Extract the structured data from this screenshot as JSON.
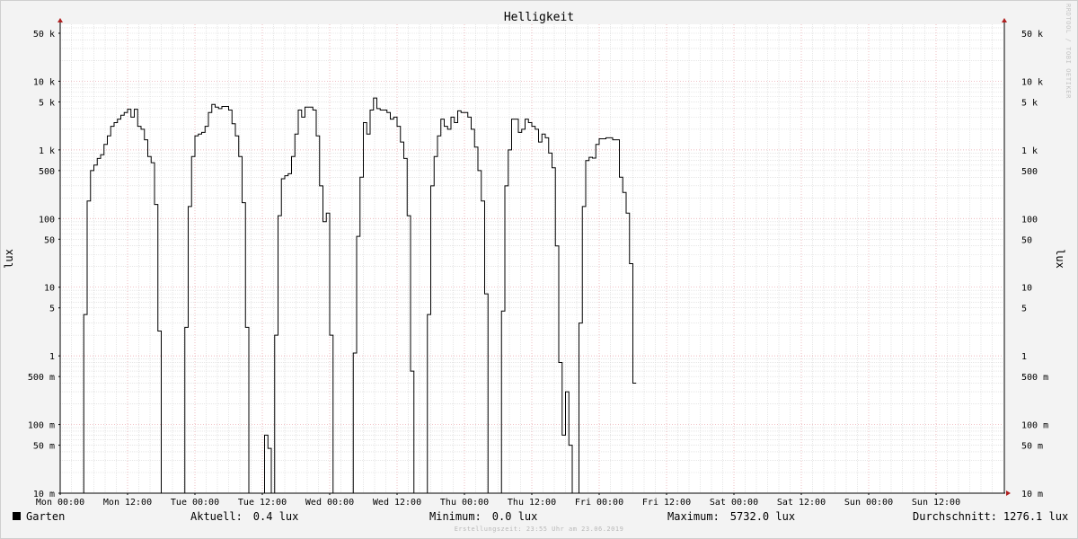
{
  "chart_data": {
    "type": "line",
    "title": "Helligkeit",
    "ylabel": "lux",
    "ylabel_right": "lux",
    "y_scale": "log",
    "ylim": [
      0.01,
      80000
    ],
    "y_ticks": [
      {
        "value": 50000,
        "label": "50 k"
      },
      {
        "value": 10000,
        "label": "10 k"
      },
      {
        "value": 5000,
        "label": "5 k"
      },
      {
        "value": 1000,
        "label": "1 k"
      },
      {
        "value": 500,
        "label": "500"
      },
      {
        "value": 100,
        "label": "100"
      },
      {
        "value": 50,
        "label": "50"
      },
      {
        "value": 10,
        "label": "10"
      },
      {
        "value": 5,
        "label": "5"
      },
      {
        "value": 1,
        "label": "1"
      },
      {
        "value": 0.5,
        "label": "500 m"
      },
      {
        "value": 0.1,
        "label": "100 m"
      },
      {
        "value": 0.05,
        "label": "50 m"
      },
      {
        "value": 0.01,
        "label": "10 m"
      }
    ],
    "x_unit": "hours since Mon 00:00",
    "xlim": [
      0,
      168
    ],
    "x_ticks": [
      {
        "value": 0,
        "label": "Mon 00:00"
      },
      {
        "value": 12,
        "label": "Mon 12:00"
      },
      {
        "value": 24,
        "label": "Tue 00:00"
      },
      {
        "value": 36,
        "label": "Tue 12:00"
      },
      {
        "value": 48,
        "label": "Wed 00:00"
      },
      {
        "value": 60,
        "label": "Wed 12:00"
      },
      {
        "value": 72,
        "label": "Thu 00:00"
      },
      {
        "value": 84,
        "label": "Thu 12:00"
      },
      {
        "value": 96,
        "label": "Fri 00:00"
      },
      {
        "value": 108,
        "label": "Fri 12:00"
      },
      {
        "value": 120,
        "label": "Sat 00:00"
      },
      {
        "value": 132,
        "label": "Sat 12:00"
      },
      {
        "value": 144,
        "label": "Sun 00:00"
      },
      {
        "value": 156,
        "label": "Sun 12:00"
      }
    ],
    "grid": true,
    "legend_position": "bottom-left",
    "series": [
      {
        "name": "Garten",
        "color": "#000000",
        "points": [
          [
            0,
            0.01
          ],
          [
            4.2,
            0.01
          ],
          [
            4.2,
            4
          ],
          [
            4.8,
            4
          ],
          [
            4.8,
            180
          ],
          [
            5.4,
            180
          ],
          [
            5.4,
            500
          ],
          [
            6,
            500
          ],
          [
            6,
            600
          ],
          [
            6.6,
            600
          ],
          [
            6.6,
            750
          ],
          [
            7.2,
            750
          ],
          [
            7.2,
            850
          ],
          [
            7.8,
            850
          ],
          [
            7.8,
            1200
          ],
          [
            8.4,
            1200
          ],
          [
            8.4,
            1600
          ],
          [
            9,
            1600
          ],
          [
            9,
            2200
          ],
          [
            9.6,
            2200
          ],
          [
            9.6,
            2500
          ],
          [
            10.2,
            2500
          ],
          [
            10.2,
            2800
          ],
          [
            10.8,
            2800
          ],
          [
            10.8,
            3200
          ],
          [
            11.4,
            3200
          ],
          [
            11.4,
            3500
          ],
          [
            12,
            3500
          ],
          [
            12,
            3900
          ],
          [
            12.6,
            3900
          ],
          [
            12.6,
            3000
          ],
          [
            13.2,
            3000
          ],
          [
            13.2,
            3900
          ],
          [
            13.8,
            3900
          ],
          [
            13.8,
            2200
          ],
          [
            14.4,
            2200
          ],
          [
            14.4,
            2000
          ],
          [
            15,
            2000
          ],
          [
            15,
            1400
          ],
          [
            15.6,
            1400
          ],
          [
            15.6,
            800
          ],
          [
            16.2,
            800
          ],
          [
            16.2,
            650
          ],
          [
            16.8,
            650
          ],
          [
            16.8,
            160
          ],
          [
            17.4,
            160
          ],
          [
            17.4,
            2.3
          ],
          [
            18,
            2.3
          ],
          [
            18,
            0.01
          ],
          [
            22.2,
            0.01
          ],
          [
            22.2,
            2.6
          ],
          [
            22.8,
            2.6
          ],
          [
            22.8,
            150
          ],
          [
            23.4,
            150
          ],
          [
            23.4,
            800
          ],
          [
            24,
            800
          ],
          [
            24,
            1600
          ],
          [
            24.6,
            1600
          ],
          [
            24.6,
            1700
          ],
          [
            25.2,
            1700
          ],
          [
            25.2,
            1800
          ],
          [
            25.8,
            1800
          ],
          [
            25.8,
            2200
          ],
          [
            26.4,
            2200
          ],
          [
            26.4,
            3500
          ],
          [
            27,
            3500
          ],
          [
            27,
            4600
          ],
          [
            27.6,
            4600
          ],
          [
            27.6,
            4200
          ],
          [
            28.2,
            4200
          ],
          [
            28.2,
            4000
          ],
          [
            28.8,
            4000
          ],
          [
            28.8,
            4300
          ],
          [
            30,
            4300
          ],
          [
            30,
            3800
          ],
          [
            30.6,
            3800
          ],
          [
            30.6,
            2400
          ],
          [
            31.2,
            2400
          ],
          [
            31.2,
            1600
          ],
          [
            31.8,
            1600
          ],
          [
            31.8,
            800
          ],
          [
            32.4,
            800
          ],
          [
            32.4,
            170
          ],
          [
            33,
            170
          ],
          [
            33,
            2.6
          ],
          [
            33.6,
            2.6
          ],
          [
            33.6,
            0.01
          ],
          [
            36.4,
            0.01
          ],
          [
            36.4,
            0.07
          ],
          [
            37,
            0.07
          ],
          [
            37,
            0.045
          ],
          [
            37.6,
            0.045
          ],
          [
            37.6,
            0.01
          ],
          [
            38.2,
            0.01
          ],
          [
            38.2,
            2
          ],
          [
            38.8,
            2
          ],
          [
            38.8,
            110
          ],
          [
            39.4,
            110
          ],
          [
            39.4,
            380
          ],
          [
            40,
            380
          ],
          [
            40,
            420
          ],
          [
            40.6,
            420
          ],
          [
            40.6,
            450
          ],
          [
            41.2,
            450
          ],
          [
            41.2,
            800
          ],
          [
            41.8,
            800
          ],
          [
            41.8,
            1700
          ],
          [
            42.4,
            1700
          ],
          [
            42.4,
            3800
          ],
          [
            43,
            3800
          ],
          [
            43,
            3000
          ],
          [
            43.6,
            3000
          ],
          [
            43.6,
            4200
          ],
          [
            45,
            4200
          ],
          [
            45,
            3800
          ],
          [
            45.6,
            3800
          ],
          [
            45.6,
            1600
          ],
          [
            46.2,
            1600
          ],
          [
            46.2,
            300
          ],
          [
            46.8,
            300
          ],
          [
            46.8,
            90
          ],
          [
            47.4,
            90
          ],
          [
            47.4,
            120
          ],
          [
            48,
            120
          ],
          [
            48,
            2
          ],
          [
            48.6,
            2
          ],
          [
            48.6,
            0.01
          ],
          [
            52.2,
            0.01
          ],
          [
            52.2,
            1.1
          ],
          [
            52.8,
            1.1
          ],
          [
            52.8,
            55
          ],
          [
            53.4,
            55
          ],
          [
            53.4,
            400
          ],
          [
            54,
            400
          ],
          [
            54,
            2500
          ],
          [
            54.6,
            2500
          ],
          [
            54.6,
            1700
          ],
          [
            55.2,
            1700
          ],
          [
            55.2,
            3800
          ],
          [
            55.8,
            3800
          ],
          [
            55.8,
            5700
          ],
          [
            56.4,
            5700
          ],
          [
            56.4,
            4000
          ],
          [
            57,
            4000
          ],
          [
            57,
            3800
          ],
          [
            58.2,
            3800
          ],
          [
            58.2,
            3500
          ],
          [
            58.8,
            3500
          ],
          [
            58.8,
            2800
          ],
          [
            59.4,
            2800
          ],
          [
            59.4,
            3000
          ],
          [
            60,
            3000
          ],
          [
            60,
            2200
          ],
          [
            60.6,
            2200
          ],
          [
            60.6,
            1300
          ],
          [
            61.2,
            1300
          ],
          [
            61.2,
            750
          ],
          [
            61.8,
            750
          ],
          [
            61.8,
            110
          ],
          [
            62.4,
            110
          ],
          [
            62.4,
            0.6
          ],
          [
            63,
            0.6
          ],
          [
            63,
            0.01
          ],
          [
            65.4,
            0.01
          ],
          [
            65.4,
            4
          ],
          [
            66,
            4
          ],
          [
            66,
            300
          ],
          [
            66.6,
            300
          ],
          [
            66.6,
            800
          ],
          [
            67.2,
            800
          ],
          [
            67.2,
            1600
          ],
          [
            67.8,
            1600
          ],
          [
            67.8,
            2800
          ],
          [
            68.4,
            2800
          ],
          [
            68.4,
            2200
          ],
          [
            69,
            2200
          ],
          [
            69,
            2000
          ],
          [
            69.6,
            2000
          ],
          [
            69.6,
            3000
          ],
          [
            70.2,
            3000
          ],
          [
            70.2,
            2500
          ],
          [
            70.8,
            2500
          ],
          [
            70.8,
            3700
          ],
          [
            71.4,
            3700
          ],
          [
            71.4,
            3500
          ],
          [
            72.6,
            3500
          ],
          [
            72.6,
            3000
          ],
          [
            73.2,
            3000
          ],
          [
            73.2,
            2000
          ],
          [
            73.8,
            2000
          ],
          [
            73.8,
            1100
          ],
          [
            74.4,
            1100
          ],
          [
            74.4,
            500
          ],
          [
            75,
            500
          ],
          [
            75,
            180
          ],
          [
            75.6,
            180
          ],
          [
            75.6,
            8
          ],
          [
            76.2,
            8
          ],
          [
            76.2,
            0.01
          ],
          [
            78.6,
            0.01
          ],
          [
            78.6,
            4.5
          ],
          [
            79.2,
            4.5
          ],
          [
            79.2,
            300
          ],
          [
            79.8,
            300
          ],
          [
            79.8,
            1000
          ],
          [
            80.4,
            1000
          ],
          [
            80.4,
            2800
          ],
          [
            81.6,
            2800
          ],
          [
            81.6,
            1800
          ],
          [
            82.2,
            1800
          ],
          [
            82.2,
            2000
          ],
          [
            82.8,
            2000
          ],
          [
            82.8,
            2800
          ],
          [
            83.4,
            2800
          ],
          [
            83.4,
            2500
          ],
          [
            84,
            2500
          ],
          [
            84,
            2200
          ],
          [
            84.6,
            2200
          ],
          [
            84.6,
            2000
          ],
          [
            85.2,
            2000
          ],
          [
            85.2,
            1300
          ],
          [
            85.8,
            1300
          ],
          [
            85.8,
            1700
          ],
          [
            86.4,
            1700
          ],
          [
            86.4,
            1500
          ],
          [
            87,
            1500
          ],
          [
            87,
            900
          ],
          [
            87.6,
            900
          ],
          [
            87.6,
            550
          ],
          [
            88.2,
            550
          ],
          [
            88.2,
            40
          ],
          [
            88.8,
            40
          ],
          [
            88.8,
            0.8
          ],
          [
            89.4,
            0.8
          ],
          [
            89.4,
            0.07
          ],
          [
            90,
            0.07
          ],
          [
            90,
            0.3
          ],
          [
            90.6,
            0.3
          ],
          [
            90.6,
            0.05
          ],
          [
            91.2,
            0.05
          ],
          [
            91.2,
            0.01
          ],
          [
            92.4,
            0.01
          ],
          [
            92.4,
            3
          ],
          [
            93,
            3
          ],
          [
            93,
            150
          ],
          [
            93.6,
            150
          ],
          [
            93.6,
            700
          ],
          [
            94.2,
            700
          ],
          [
            94.2,
            780
          ],
          [
            94.8,
            780
          ],
          [
            94.8,
            760
          ],
          [
            95.4,
            760
          ],
          [
            95.4,
            1200
          ],
          [
            96,
            1200
          ],
          [
            96,
            1450
          ],
          [
            97.2,
            1450
          ],
          [
            97.2,
            1500
          ],
          [
            98.4,
            1500
          ],
          [
            98.4,
            1400
          ],
          [
            99.6,
            1400
          ],
          [
            99.6,
            400
          ],
          [
            100.2,
            400
          ],
          [
            100.2,
            240
          ],
          [
            100.8,
            240
          ],
          [
            100.8,
            120
          ],
          [
            101.4,
            120
          ],
          [
            101.4,
            22
          ],
          [
            102,
            22
          ],
          [
            102,
            0.4
          ],
          [
            102.6,
            0.4
          ]
        ]
      }
    ]
  },
  "footer": {
    "legend_label": "Garten",
    "current_label": "Aktuell:",
    "current_value": "0.4 lux",
    "minimum_label": "Minimum:",
    "minimum_value": "0.0 lux",
    "maximum_label": "Maximum:",
    "maximum_value": "5732.0 lux",
    "average_label": "Durchschnitt:",
    "average_value": "1276.1 lux",
    "creation_text": "Erstellungszeit: 23:55 Uhr am 23.06.2019",
    "watermark": "RRDTOOL / TOBI OETIKER"
  },
  "colors": {
    "background": "#f3f3f3",
    "plot_background": "#ffffff",
    "major_grid": "#e8a0a8",
    "minor_grid": "#d8d8d8",
    "line": "#000000",
    "axis_arrow": "#b02020"
  }
}
